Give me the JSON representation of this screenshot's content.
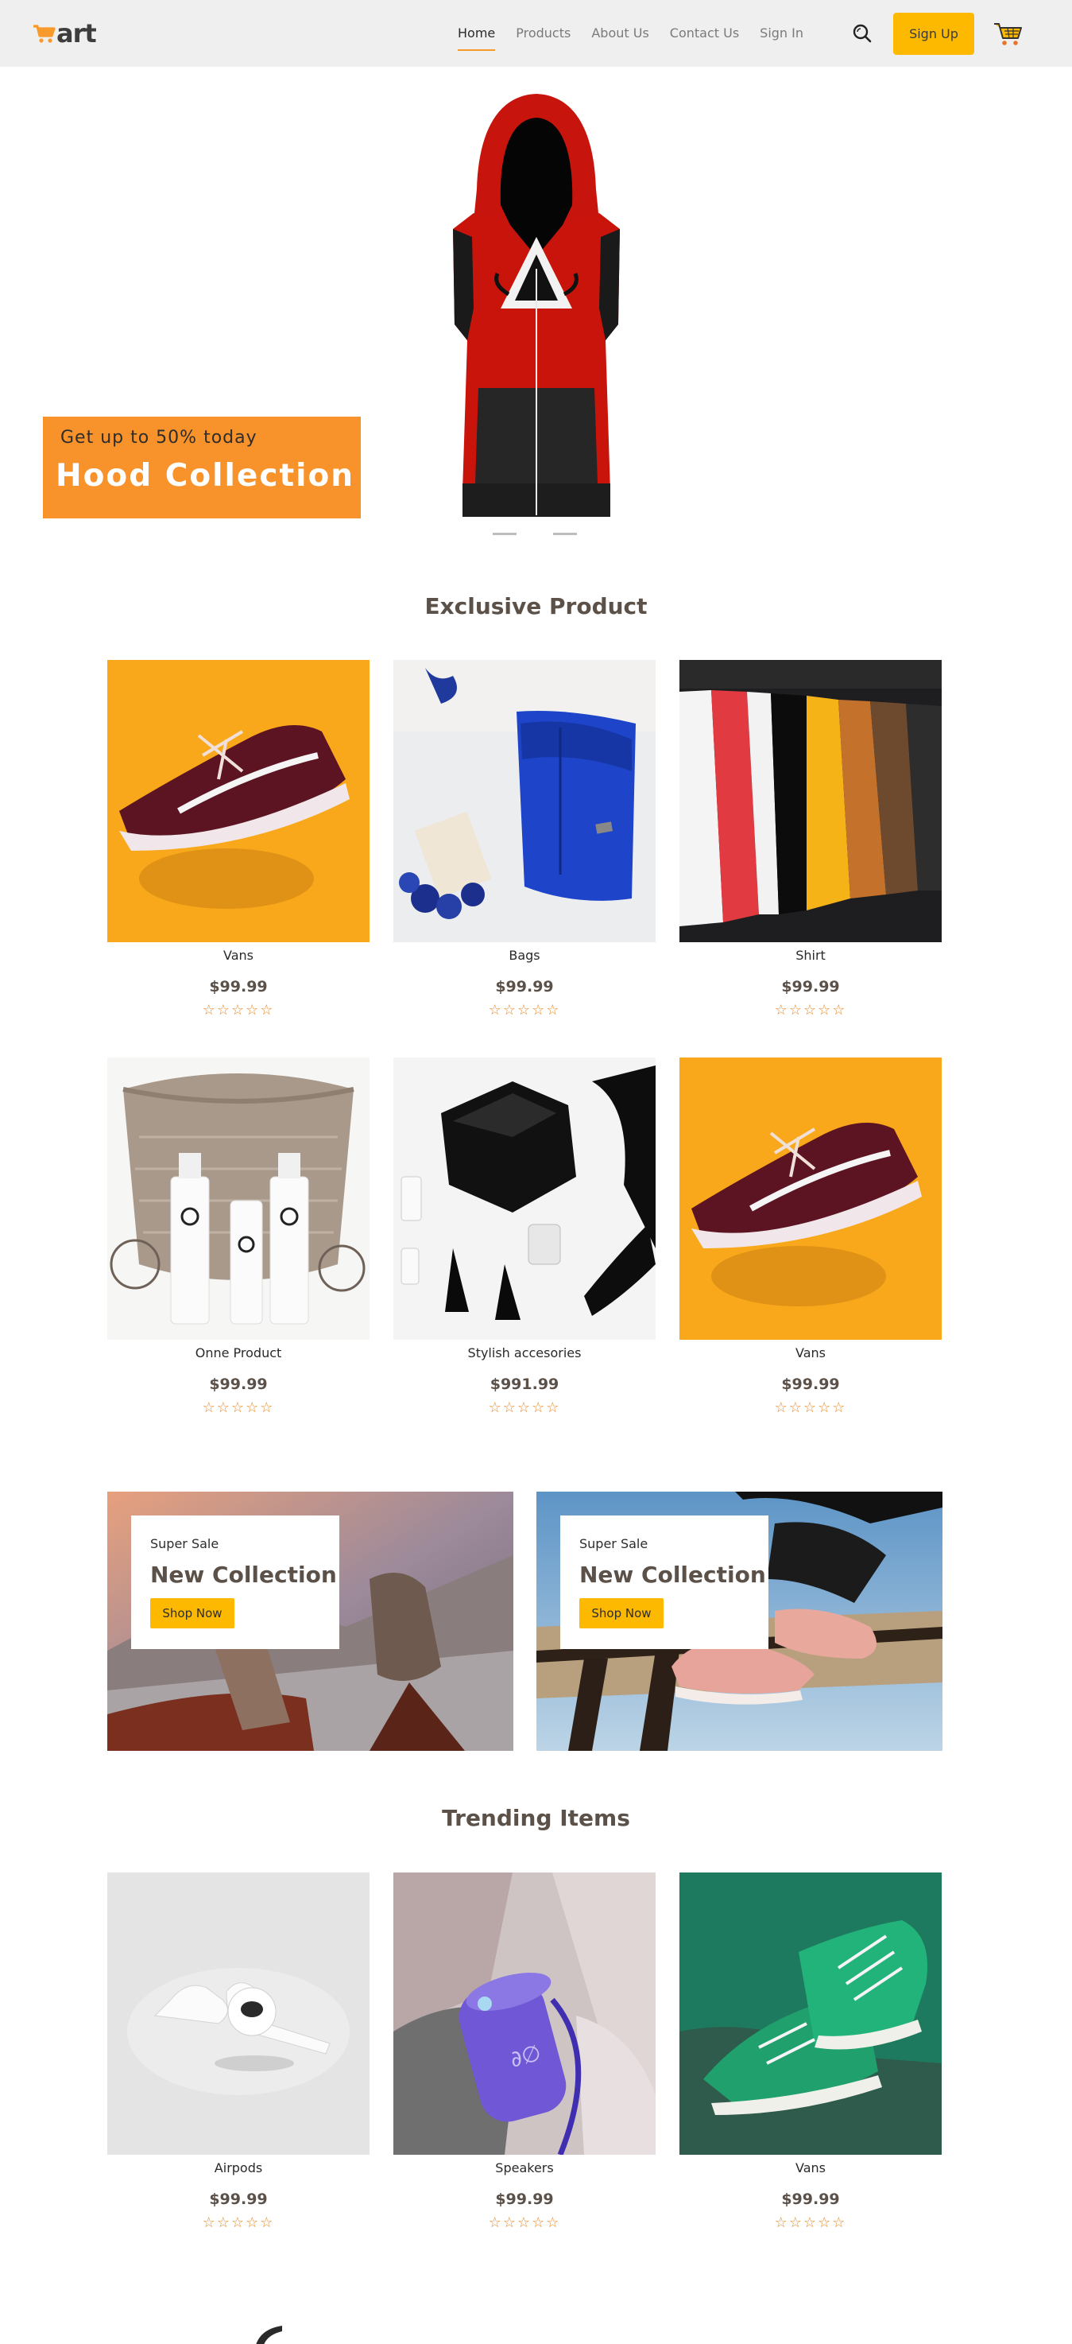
{
  "header": {
    "logo_text": "art",
    "nav": [
      "Home",
      "Products",
      "About Us",
      "Contact Us",
      "Sign In"
    ],
    "signup_label": "Sign Up",
    "accent_color": "#f89a2b",
    "button_color": "#fcb900"
  },
  "hero": {
    "subtitle": "Get up to 50% today",
    "title": "Hood Collection",
    "slides_total": 3,
    "active_slide": 2
  },
  "exclusive": {
    "title": "Exclusive Product",
    "products": [
      {
        "name": "Vans",
        "price": "$99.99",
        "stars": "☆☆☆☆☆",
        "image": "red-sneaker-on-orange"
      },
      {
        "name": "Bags",
        "price": "$99.99",
        "stars": "☆☆☆☆☆",
        "image": "blue-backpack"
      },
      {
        "name": "Shirt",
        "price": "$99.99",
        "stars": "☆☆☆☆☆",
        "image": "shirts-on-rack"
      },
      {
        "name": "Onne Product",
        "price": "$99.99",
        "stars": "☆☆☆☆☆",
        "image": "lotion-bottles-basket"
      },
      {
        "name": "Stylish accesories",
        "price": "$991.99",
        "stars": "☆☆☆☆☆",
        "image": "black-clutch-heels"
      },
      {
        "name": "Vans",
        "price": "$99.99",
        "stars": "☆☆☆☆☆",
        "image": "red-sneaker-on-orange"
      }
    ]
  },
  "sale": [
    {
      "label": "Super Sale",
      "title": "New Collection",
      "button": "Shop Now",
      "image": "boots-on-mountain"
    },
    {
      "label": "Super Sale",
      "title": "New Collection",
      "button": "Shop Now",
      "image": "pink-sneakers-on-railing"
    }
  ],
  "trending": {
    "title": "Trending Items",
    "products": [
      {
        "name": "Airpods",
        "price": "$99.99",
        "stars": "☆☆☆☆☆",
        "image": "white-earbuds"
      },
      {
        "name": "Speakers",
        "price": "$99.99",
        "stars": "☆☆☆☆☆",
        "image": "purple-speaker"
      },
      {
        "name": "Vans",
        "price": "$99.99",
        "stars": "☆☆☆☆☆",
        "image": "green-sneakers"
      }
    ]
  }
}
